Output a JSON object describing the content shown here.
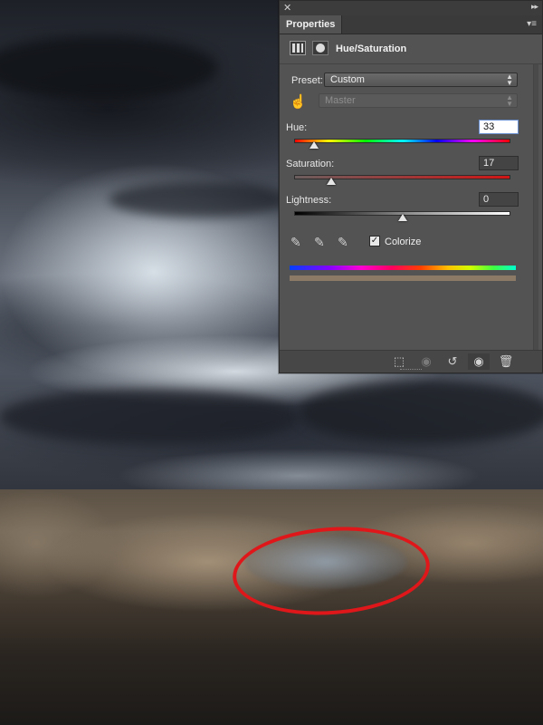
{
  "panel": {
    "tab_label": "Properties",
    "close_glyph": "✕",
    "collapse_glyph": "▸▸",
    "menu_glyph": "▾≡",
    "adjustment_title": "Hue/Saturation",
    "preset_label": "Preset:",
    "preset_value": "Custom",
    "channel_value": "Master",
    "hue": {
      "label": "Hue:",
      "value": "33",
      "fraction": 0.09
    },
    "saturation": {
      "label": "Saturation:",
      "value": "17",
      "fraction": 0.17
    },
    "lightness": {
      "label": "Lightness:",
      "value": "0",
      "fraction": 0.5
    },
    "colorize_label": "Colorize",
    "colorize_checked": true,
    "check_glyph": "✓",
    "icons": {
      "adjustment": "hue-saturation-icon",
      "mask": "layer-mask-icon",
      "target_adjust": "hand-icon",
      "eyedropper": "eyedropper-icon",
      "eyedropper_plus": "eyedropper-add-icon",
      "eyedropper_minus": "eyedropper-subtract-icon",
      "clip": "clip-to-layer-icon",
      "view_previous": "view-previous-icon",
      "reset": "reset-icon",
      "visibility": "eye-icon",
      "delete": "trash-icon"
    },
    "colors": {
      "panel_bg": "#535353",
      "result_bar": "#8c7966",
      "annotation": "#e0171a"
    }
  }
}
